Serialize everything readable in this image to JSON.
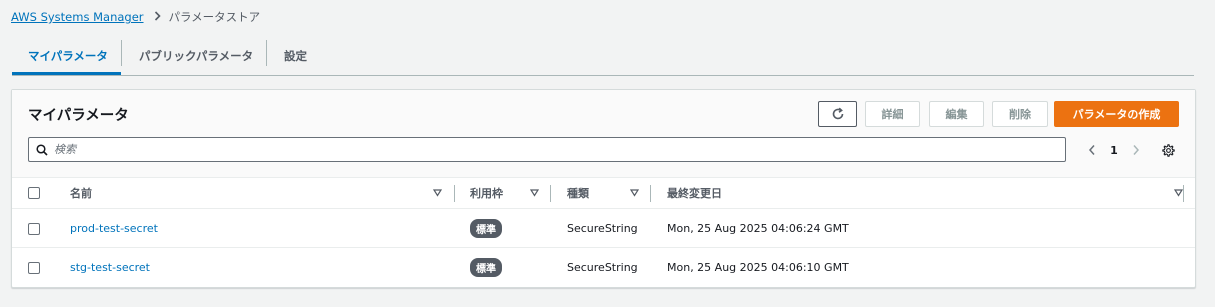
{
  "breadcrumb": {
    "root": "AWS Systems Manager",
    "current": "パラメータストア"
  },
  "tabs": [
    {
      "label": "マイパラメータ",
      "active": true
    },
    {
      "label": "パブリックパラメータ",
      "active": false
    },
    {
      "label": "設定",
      "active": false
    }
  ],
  "panel": {
    "title": "マイパラメータ",
    "buttons": {
      "refresh_icon": "refresh-icon",
      "details": "詳細",
      "edit": "編集",
      "delete": "削除",
      "create": "パラメータの作成"
    },
    "search_placeholder": "検索",
    "page_number": "1"
  },
  "table": {
    "columns": [
      "名前",
      "利用枠",
      "種類",
      "最終変更日"
    ],
    "rows": [
      {
        "name": "prod-test-secret",
        "tier": "標準",
        "type": "SecureString",
        "last_modified": "Mon, 25 Aug 2025 04:06:24 GMT"
      },
      {
        "name": "stg-test-secret",
        "tier": "標準",
        "type": "SecureString",
        "last_modified": "Mon, 25 Aug 2025 04:06:10 GMT"
      }
    ]
  },
  "colors": {
    "link": "#0073bb",
    "primary_button": "#ec7211",
    "badge": "#545b64"
  }
}
